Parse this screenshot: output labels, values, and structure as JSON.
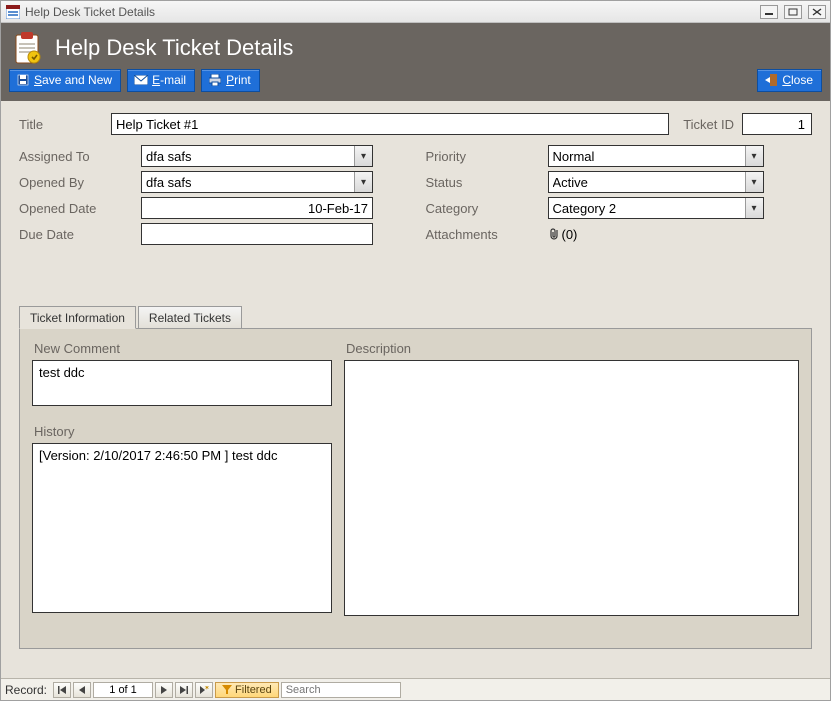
{
  "window": {
    "title": "Help Desk Ticket Details"
  },
  "header": {
    "title": "Help Desk Ticket Details"
  },
  "toolbar": {
    "save_new": {
      "prefix": "S",
      "rest": "ave and New"
    },
    "email": {
      "prefix": "E",
      "rest": "-mail"
    },
    "print": {
      "prefix": "P",
      "rest": "rint"
    },
    "close": {
      "prefix": "C",
      "rest": "lose"
    }
  },
  "fields": {
    "title_label": "Title",
    "title_value": "Help Ticket #1",
    "ticket_id_label": "Ticket ID",
    "ticket_id_value": "1",
    "assigned_to_label": "Assigned To",
    "assigned_to_value": "dfa safs",
    "opened_by_label": "Opened By",
    "opened_by_value": "dfa safs",
    "opened_date_label": "Opened Date",
    "opened_date_value": "10-Feb-17",
    "due_date_label": "Due Date",
    "due_date_value": "",
    "priority_label": "Priority",
    "priority_value": "Normal",
    "status_label": "Status",
    "status_value": "Active",
    "category_label": "Category",
    "category_value": "Category 2",
    "attachments_label": "Attachments",
    "attachments_value": "(0)"
  },
  "tabs": {
    "ticket_info": "Ticket Information",
    "related": "Related Tickets"
  },
  "panel": {
    "new_comment_label": "New Comment",
    "new_comment_value": "test ddc",
    "history_label": "History",
    "history_value": "[Version:  2/10/2017 2:46:50 PM ] test ddc",
    "description_label": "Description",
    "description_value": ""
  },
  "recordbar": {
    "label": "Record:",
    "position": "1 of 1",
    "filtered": "Filtered",
    "search_placeholder": "Search"
  }
}
